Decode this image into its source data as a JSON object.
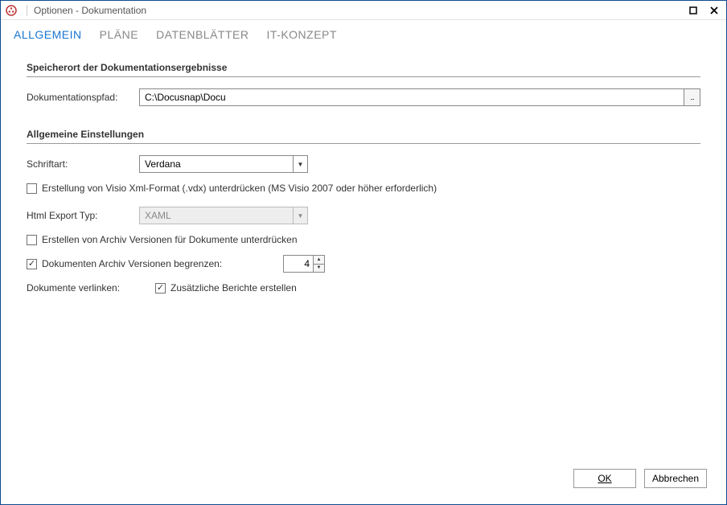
{
  "window": {
    "title": "Optionen - Dokumentation"
  },
  "tabs": [
    {
      "label": "ALLGEMEIN",
      "active": true
    },
    {
      "label": "PLÄNE",
      "active": false
    },
    {
      "label": "DATENBLÄTTER",
      "active": false
    },
    {
      "label": "IT-KONZEPT",
      "active": false
    }
  ],
  "section1": {
    "header": "Speicherort der Dokumentationsergebnisse",
    "path_label": "Dokumentationspfad:",
    "path_value": "C:\\Docusnap\\Docu",
    "browse_label": "..."
  },
  "section2": {
    "header": "Allgemeine Einstellungen",
    "font_label": "Schriftart:",
    "font_value": "Verdana",
    "visio_suppress_label": "Erstellung von Visio Xml-Format (.vdx) unterdrücken (MS Visio 2007 oder höher erforderlich)",
    "visio_suppress_checked": false,
    "export_type_label": "Html Export Typ:",
    "export_type_value": "XAML",
    "archive_suppress_label": "Erstellen von Archiv Versionen für Dokumente unterdrücken",
    "archive_suppress_checked": false,
    "archive_limit_label": "Dokumenten Archiv Versionen begrenzen:",
    "archive_limit_checked": true,
    "archive_limit_value": "4",
    "link_docs_label": "Dokumente verlinken:",
    "additional_reports_label": "Zusätzliche Berichte erstellen",
    "additional_reports_checked": true
  },
  "footer": {
    "ok_label": "OK",
    "cancel_label": "Abbrechen"
  }
}
